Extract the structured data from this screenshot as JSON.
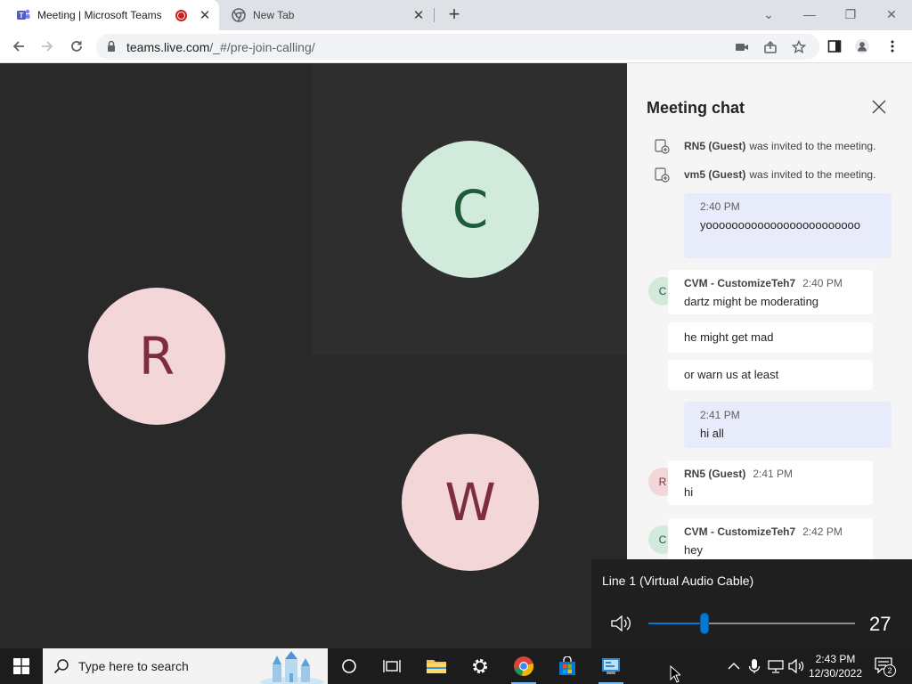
{
  "browser": {
    "tabs": [
      {
        "title": "Meeting | Microsoft Teams",
        "active": true
      },
      {
        "title": "New Tab",
        "active": false
      }
    ],
    "url_host": "teams.live.com",
    "url_path": "/_#/pre-join-calling/"
  },
  "stage": {
    "participants": [
      {
        "initial": "R",
        "color": "#f3d6d8"
      },
      {
        "initial": "C",
        "color": "#d2eadb"
      },
      {
        "initial": "W",
        "color": "#f3d6d8"
      }
    ]
  },
  "chat": {
    "title": "Meeting chat",
    "system_messages": [
      {
        "name": "RN5 (Guest)",
        "text": "was invited to the meeting."
      },
      {
        "name": "vm5 (Guest)",
        "text": "was invited to the meeting."
      }
    ],
    "messages": [
      {
        "kind": "mine",
        "time": "2:40 PM",
        "text": "yoooooooooooooooooooooooo"
      },
      {
        "kind": "other",
        "initial": "C",
        "name": "CVM - CustomizeTeh7",
        "time": "2:40 PM",
        "text": "dartz might be moderating"
      },
      {
        "kind": "cont",
        "text": "he might get mad"
      },
      {
        "kind": "cont",
        "text": "or warn us at least"
      },
      {
        "kind": "mine",
        "time": "2:41 PM",
        "text": "hi all"
      },
      {
        "kind": "other",
        "initial": "R",
        "name": "RN5 (Guest)",
        "time": "2:41 PM",
        "text": "hi"
      },
      {
        "kind": "other",
        "initial": "C",
        "name": "CVM - CustomizeTeh7",
        "time": "2:42 PM",
        "text": "hey"
      }
    ]
  },
  "volume": {
    "device": "Line 1 (Virtual Audio Cable)",
    "level": 27
  },
  "taskbar": {
    "search_placeholder": "Type here to search",
    "time": "2:43 PM",
    "date": "12/30/2022",
    "notification_count": "2"
  },
  "colors": {
    "accent": "#0078d4",
    "stage_bg": "#292929",
    "my_bubble": "#e8ebfa"
  }
}
